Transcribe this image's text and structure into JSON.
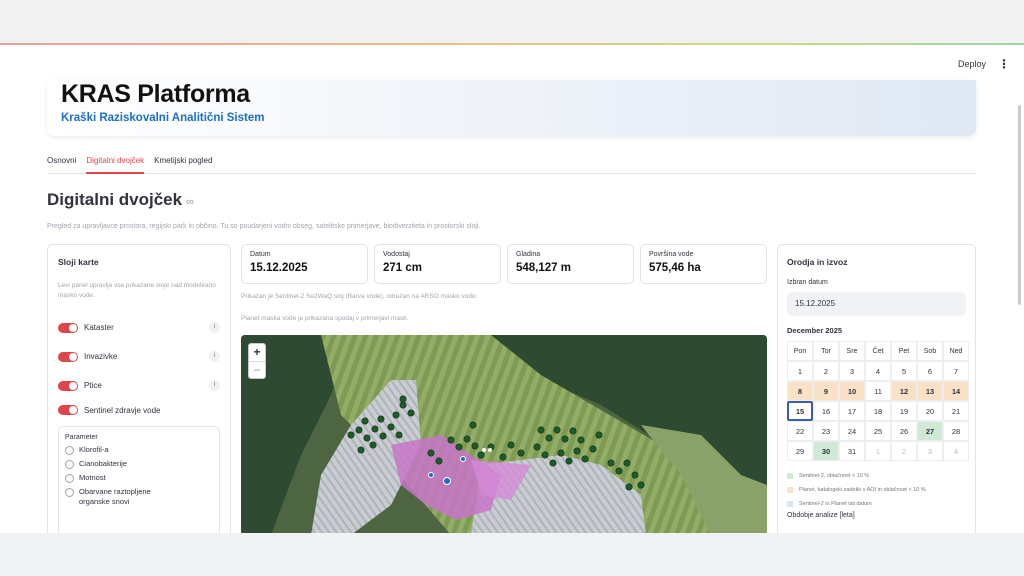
{
  "toolbar": {
    "deploy": "Deploy",
    "menu_icon": "kebab-menu-icon"
  },
  "header": {
    "title": "KRAS Platforma",
    "subtitle": "Kraški Raziskovalni Analitični Sistem"
  },
  "tabs": [
    {
      "label": "Osnovni",
      "active": false
    },
    {
      "label": "Digitalni dvojček",
      "active": true
    },
    {
      "label": "Kmetijski pogled",
      "active": false
    }
  ],
  "page": {
    "title": "Digitalni dvojček",
    "link_icon": "∞",
    "description": "Pregled za upravljavce prostora, regijski park in občino. Tu so poudarjeni vodni obseg, satelitske primerjave, biodiverziteta in prostorski sloji."
  },
  "left_panel": {
    "title": "Sloji karte",
    "help": "Levi panel upravlja vse prikazane sloje nad modelirano masko vode.",
    "layers": [
      {
        "label": "Kataster",
        "on": true,
        "info": "i"
      },
      {
        "label": "Invazivke",
        "on": true,
        "info": "i"
      },
      {
        "label": "Ptice",
        "on": true,
        "info": "i"
      },
      {
        "label": "Sentinel zdravje vode",
        "on": true,
        "info": ""
      }
    ],
    "parameter": {
      "title": "Parameter",
      "options": [
        "Klorofil-a",
        "Cianobakterije",
        "Motnost",
        "Obarvane raztopljene organske snovi"
      ]
    }
  },
  "metrics": [
    {
      "label": "Datum",
      "value": "15.12.2025"
    },
    {
      "label": "Vodostaj",
      "value": "271 cm"
    },
    {
      "label": "Gladina",
      "value": "548,127 m"
    },
    {
      "label": "Površina vode",
      "value": "575,46 ha"
    }
  ],
  "notes": {
    "line1": "Prikazan je Sentinel-2 Se2WaQ sloj (Barva vode), odrezan na ARSO masko vode.",
    "line2": "Planet maska vode je prikazana spodaj v primerjavi mask."
  },
  "map": {
    "zoom_in": "+",
    "zoom_out": "−"
  },
  "right_panel": {
    "title": "Orodja in izvoz",
    "date_label": "Izbran datum",
    "date_value": "15.12.2025",
    "month": "December 2025",
    "weekdays": [
      "Pon",
      "Tor",
      "Sre",
      "Čet",
      "Pet",
      "Sob",
      "Ned"
    ],
    "days": [
      {
        "d": "1"
      },
      {
        "d": "2"
      },
      {
        "d": "3"
      },
      {
        "d": "4"
      },
      {
        "d": "5"
      },
      {
        "d": "6"
      },
      {
        "d": "7"
      },
      {
        "d": "8",
        "c": "orange"
      },
      {
        "d": "9",
        "c": "orange"
      },
      {
        "d": "10",
        "c": "orange"
      },
      {
        "d": "11"
      },
      {
        "d": "12",
        "c": "orange"
      },
      {
        "d": "13",
        "c": "orange"
      },
      {
        "d": "14",
        "c": "orange"
      },
      {
        "d": "15",
        "c": "sel"
      },
      {
        "d": "16"
      },
      {
        "d": "17"
      },
      {
        "d": "18"
      },
      {
        "d": "19"
      },
      {
        "d": "20"
      },
      {
        "d": "21"
      },
      {
        "d": "22"
      },
      {
        "d": "23"
      },
      {
        "d": "24"
      },
      {
        "d": "25"
      },
      {
        "d": "26"
      },
      {
        "d": "27",
        "c": "green"
      },
      {
        "d": "28"
      },
      {
        "d": "29"
      },
      {
        "d": "30",
        "c": "green"
      },
      {
        "d": "31"
      },
      {
        "d": "1",
        "c": "dim"
      },
      {
        "d": "2",
        "c": "dim"
      },
      {
        "d": "3",
        "c": "dim"
      },
      {
        "d": "4",
        "c": "dim"
      }
    ],
    "legend": [
      {
        "label": "Sentinel-2, oblačnost < 10 %",
        "color": "#cfe9d4"
      },
      {
        "label": "Planet, katalogski zadetki v AOI in oblačnost < 10 %",
        "color": "#fbe1c6"
      },
      {
        "label": "Sentinel-2 in Planet isti datum",
        "color": "#d7e7f2"
      }
    ],
    "period_label": "Obdobje analize [leta]"
  },
  "colors": {
    "accent": "#e0454b",
    "link": "#1c6fc4",
    "selected_day": "#3a5ca8"
  }
}
